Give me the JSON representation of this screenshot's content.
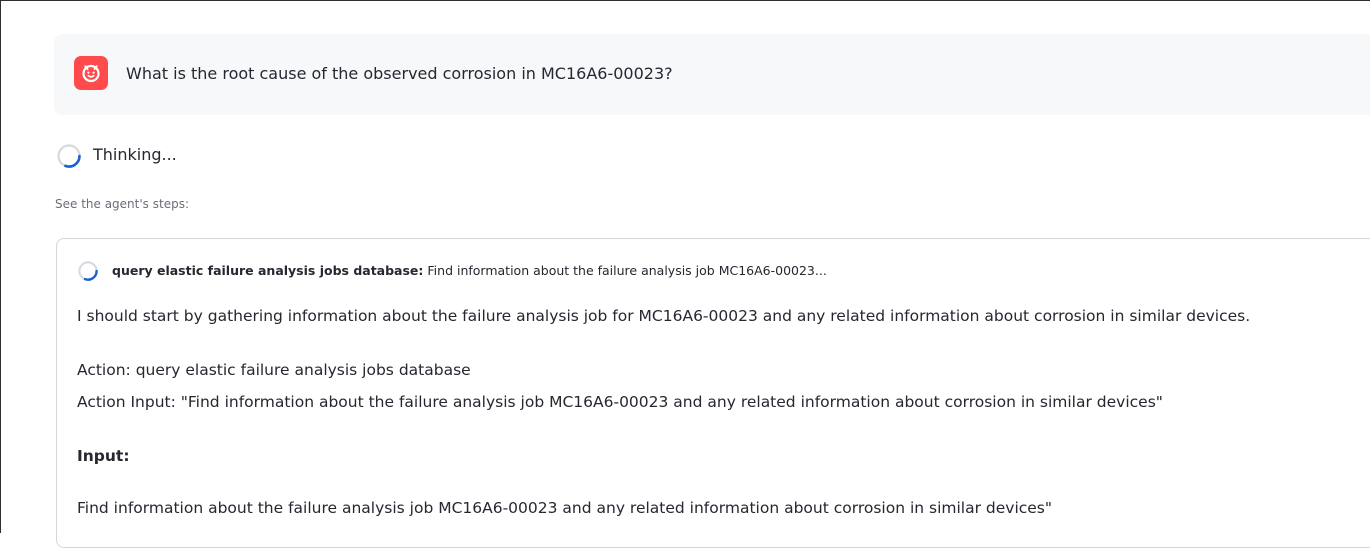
{
  "chat": {
    "user_message": "What is the root cause of the observed corrosion in MC16A6-00023?",
    "avatar_icon": "robot-face-icon",
    "accent_color": "#ff4b4b"
  },
  "status": {
    "thinking_label": "Thinking...",
    "spinner_icon": "loading-spinner-icon"
  },
  "steps": {
    "caption": "See the agent's steps:",
    "tool_name": "query elastic failure analysis jobs database:",
    "tool_query": " Find information about the failure analysis job MC16A6-00023...",
    "thought": "I should start by gathering information about the failure analysis job for MC16A6-00023 and any related information about corrosion in similar devices.",
    "action": "Action: query elastic failure analysis jobs database",
    "action_input": "Action Input: \"Find information about the failure analysis job MC16A6-00023 and any related information about corrosion in similar devices\"",
    "input_label": "Input:",
    "input_text": "Find information about the failure analysis job MC16A6-00023 and any related information about corrosion in similar devices\""
  }
}
